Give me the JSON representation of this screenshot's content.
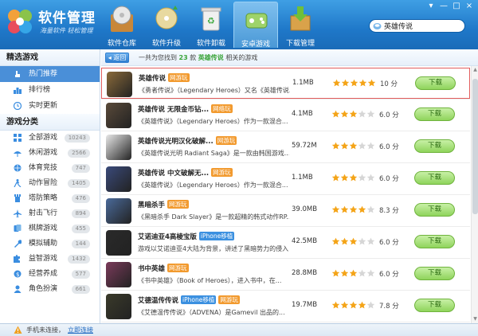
{
  "app": {
    "title": "软件管理",
    "slogan": "海量软件 轻松管理"
  },
  "window_controls": [
    "▾",
    "—",
    "□",
    "×"
  ],
  "nav": [
    {
      "label": "软件仓库",
      "icon": "disc-box-icon",
      "active": false
    },
    {
      "label": "软件升级",
      "icon": "upgrade-disc-icon",
      "active": false
    },
    {
      "label": "软件卸载",
      "icon": "recycle-bin-icon",
      "active": false
    },
    {
      "label": "安卓游戏",
      "icon": "android-gamepad-icon",
      "active": true
    },
    {
      "label": "下载管理",
      "icon": "download-box-icon",
      "active": false
    }
  ],
  "search": {
    "value": "英雄传说",
    "placeholder": ""
  },
  "sidebar": {
    "picks_title": "精选游戏",
    "picks": [
      {
        "label": "热门推荐",
        "icon": "hand-pointer-icon",
        "active": true
      },
      {
        "label": "排行榜",
        "icon": "ranking-icon",
        "active": false
      },
      {
        "label": "实时更新",
        "icon": "clock-icon",
        "active": false
      }
    ],
    "categories_title": "游戏分类",
    "categories": [
      {
        "label": "全部游戏",
        "count": "10243",
        "icon": "grid-icon"
      },
      {
        "label": "休闲游戏",
        "count": "2566",
        "icon": "leisure-icon"
      },
      {
        "label": "体育竞技",
        "count": "747",
        "icon": "sports-icon"
      },
      {
        "label": "动作冒险",
        "count": "1405",
        "icon": "action-icon"
      },
      {
        "label": "塔防策略",
        "count": "476",
        "icon": "tower-icon"
      },
      {
        "label": "射击飞行",
        "count": "894",
        "icon": "plane-icon"
      },
      {
        "label": "棋牌游戏",
        "count": "455",
        "icon": "cards-icon"
      },
      {
        "label": "模拟辅助",
        "count": "144",
        "icon": "wrench-icon"
      },
      {
        "label": "益智游戏",
        "count": "1432",
        "icon": "puzzle-icon"
      },
      {
        "label": "经营养成",
        "count": "577",
        "icon": "business-icon"
      },
      {
        "label": "角色扮演",
        "count": "661",
        "icon": "role-icon"
      }
    ]
  },
  "results": {
    "back_label": "返回",
    "prefix": "一共为您找到",
    "count": "23",
    "unit": "款",
    "keyword": "英雄传说",
    "suffix": "相关的游戏"
  },
  "games": [
    {
      "name": "英雄传说",
      "tags": [
        {
          "text": "网游玩",
          "color": "o"
        }
      ],
      "desc": "《勇者传说》（Legendary Heroes）又名《英雄传说...",
      "size": "1.1MB",
      "rating": 5,
      "score": "10 分",
      "download": "下载",
      "highlight": true,
      "thumb": "#8a6a3a"
    },
    {
      "name": "英雄传说 无限金币钻...",
      "tags": [
        {
          "text": "网络玩",
          "color": "o"
        }
      ],
      "desc": "《英雄传说》（Legendary Heroes）作为一款混合...",
      "size": "4.1MB",
      "rating": 3,
      "score": "6.0 分",
      "download": "下载",
      "highlight": false,
      "thumb": "#5a4a3a"
    },
    {
      "name": "英雄传说光明汉化破解...",
      "tags": [
        {
          "text": "网游玩",
          "color": "o"
        }
      ],
      "desc": "《英雄传说光明 Radiant Saga》是一款由韩国游戏...",
      "size": "59.72M",
      "rating": 3,
      "score": "6.0 分",
      "download": "下载",
      "highlight": false,
      "thumb": "#e8e8e8"
    },
    {
      "name": "英雄传说 中文破解无...",
      "tags": [
        {
          "text": "网游玩",
          "color": "o"
        }
      ],
      "desc": "《英雄传说》（Legendary Heroes）作为一款混合...",
      "size": "1.1MB",
      "rating": 3,
      "score": "6.0 分",
      "download": "下载",
      "highlight": false,
      "thumb": "#3a4a7a"
    },
    {
      "name": "黑暗杀手",
      "tags": [
        {
          "text": "网游玩",
          "color": "o"
        }
      ],
      "desc": "《黑暗杀手 Dark Slayer》是一款超精的韩式动作RP...",
      "size": "39.0MB",
      "rating": 4,
      "score": "8.3 分",
      "download": "下载",
      "highlight": false,
      "thumb": "#4a6a9a"
    },
    {
      "name": "艾诺迪亚4高棱宝版",
      "tags": [
        {
          "text": "iPhone移植",
          "color": "b"
        }
      ],
      "desc": "游戏以艾诺迪亚4大陆为背景，讲述了黑暗势力的侵入...",
      "size": "42.5MB",
      "rating": 3,
      "score": "6.0 分",
      "download": "下载",
      "highlight": false,
      "thumb": "#2a2a2a"
    },
    {
      "name": "书中英雄",
      "tags": [
        {
          "text": "网游玩",
          "color": "o"
        }
      ],
      "desc": "《书中英雄》（Book of Heroes），进入书中，在...",
      "size": "28.8MB",
      "rating": 3,
      "score": "6.0 分",
      "download": "下载",
      "highlight": false,
      "thumb": "#7a3a5a"
    },
    {
      "name": "艾德温传传说",
      "tags": [
        {
          "text": "iPhone移植",
          "color": "b"
        },
        {
          "text": "网游玩",
          "color": "o"
        }
      ],
      "desc": "《艾德温传传说》（ADVENA）是Gamevil 出品的...",
      "size": "19.7MB",
      "rating": 4,
      "score": "7.8 分",
      "download": "下载",
      "highlight": false,
      "thumb": "#3a3a2a"
    }
  ],
  "status": {
    "text": "手机未连接，",
    "link": "立即连接"
  }
}
